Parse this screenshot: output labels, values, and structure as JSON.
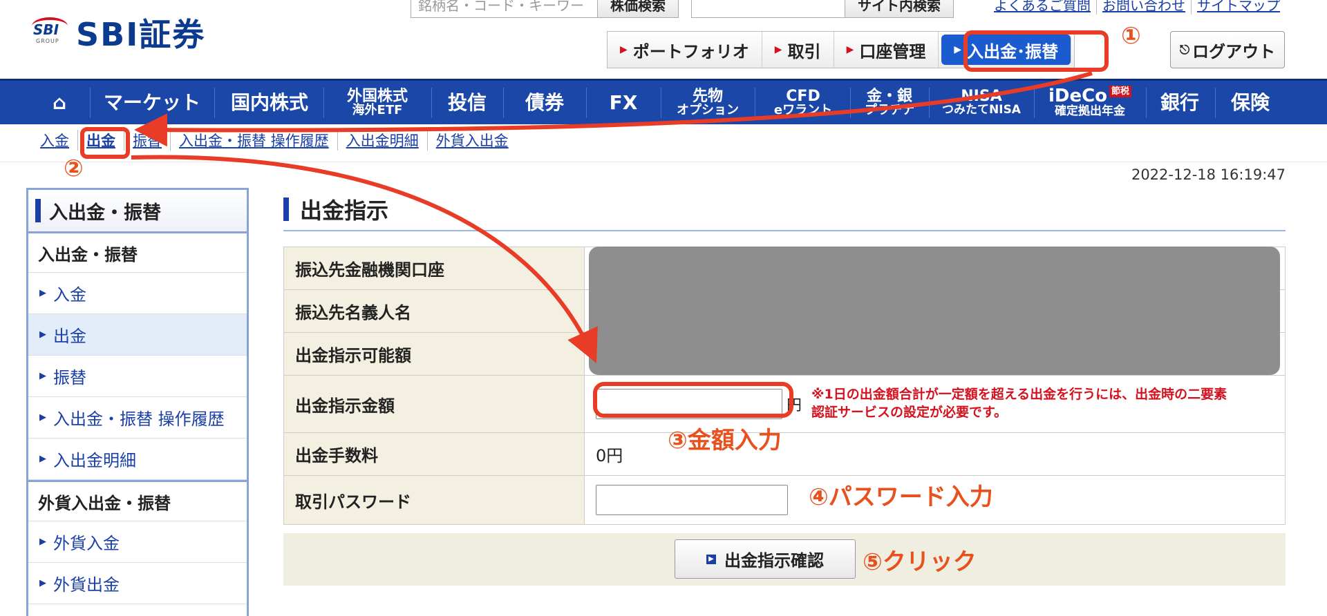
{
  "header": {
    "logo_mark": "SBI",
    "logo_group": "GROUP",
    "logo_text": "SBI証券",
    "search_placeholder": "銘柄名・コード・キーワード",
    "stock_search_button": "株価検索",
    "site_search_placeholder": "",
    "site_search_button": "サイト内検索",
    "links": [
      "よくあるご質問",
      "お問い合わせ",
      "サイトマップ"
    ],
    "subnav": [
      "ポートフォリオ",
      "取引",
      "口座管理",
      "入出金･振替"
    ],
    "logout": "ログアウト"
  },
  "global_nav": [
    {
      "label": "⌂"
    },
    {
      "label": "マーケット"
    },
    {
      "label": "国内株式"
    },
    {
      "line1": "外国株式",
      "line2": "海外ETF"
    },
    {
      "label": "投信"
    },
    {
      "label": "債券"
    },
    {
      "label": "FX"
    },
    {
      "line1": "先物",
      "line2": "オプション"
    },
    {
      "line1": "CFD",
      "line2": "eワラント"
    },
    {
      "line1": "金・銀",
      "line2": "プラチナ"
    },
    {
      "line1": "NISA",
      "line2": "つみたてNISA"
    },
    {
      "line1": "iDeCo",
      "badge": "節税",
      "line2": "確定拠出年金"
    },
    {
      "label": "銀行"
    },
    {
      "label": "保険"
    }
  ],
  "crumbs": [
    "入金",
    "出金",
    "振替",
    "入出金・振替 操作履歴",
    "入出金明細",
    "外貨入出金"
  ],
  "timestamp": "2022-12-18 16:19:47",
  "sidebar": {
    "title": "入出金・振替",
    "section1": "入出金・振替",
    "items1": [
      "入金",
      "出金",
      "振替",
      "入出金・振替 操作履歴",
      "入出金明細"
    ],
    "section2": "外貨入出金・振替",
    "items2": [
      "外貨入金",
      "外貨出金"
    ]
  },
  "main": {
    "title": "出金指示",
    "rows": {
      "account": "振込先金融機関口座",
      "name": "振込先名義人名",
      "available": "出金指示可能額",
      "amount": "出金指示金額",
      "fee": "出金手数料",
      "password": "取引パスワード"
    },
    "yen": "円",
    "warning_line1": "※1日の出金額合計が一定額を超える出金を行うには、出金時の二要素",
    "warning_line2": "認証サービスの設定が必要です。",
    "fee_value": "0円",
    "confirm_button": "出金指示確認"
  },
  "annotations": {
    "step1": "①",
    "step2": "②",
    "step3": "③金額入力",
    "step4": "④パスワード入力",
    "step5": "⑤クリック"
  },
  "colors": {
    "brand_blue": "#1a47a8",
    "annotation_red": "#e83c26",
    "annotation_orange": "#e8501e"
  }
}
